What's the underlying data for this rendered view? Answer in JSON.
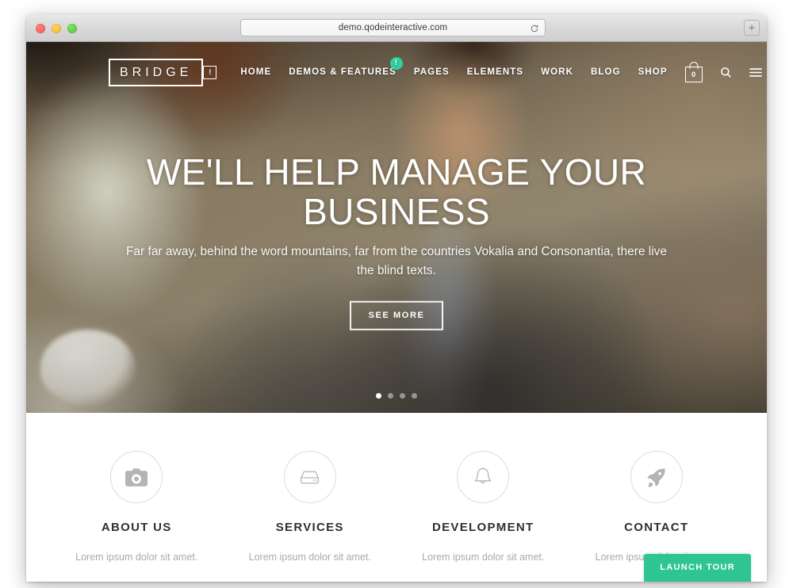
{
  "browser": {
    "url": "demo.qodeinteractive.com",
    "reload_icon": "reload-icon",
    "newtab_label": "+",
    "traffic_lights": [
      "close",
      "minimize",
      "maximize"
    ]
  },
  "site": {
    "logo": "BRIDGE",
    "nav": {
      "pre_icon_label": "!",
      "items": [
        {
          "label": "HOME",
          "badge": null
        },
        {
          "label": "DEMOS & FEATURES",
          "badge": "!"
        },
        {
          "label": "PAGES",
          "badge": null
        },
        {
          "label": "ELEMENTS",
          "badge": null
        },
        {
          "label": "WORK",
          "badge": null
        },
        {
          "label": "BLOG",
          "badge": null
        },
        {
          "label": "SHOP",
          "badge": null
        }
      ],
      "cart_count": "0",
      "search_icon": "search-icon",
      "menu_icon": "hamburger-icon"
    },
    "hero": {
      "title": "WE'LL HELP MANAGE YOUR BUSINESS",
      "subtitle": "Far far away, behind the word mountains, far from the countries Vokalia and Consonantia, there live the blind texts.",
      "button_label": "SEE MORE",
      "slider_dots": 4,
      "slider_active_index": 0
    },
    "features": [
      {
        "icon": "camera-icon",
        "title": "ABOUT US",
        "text": "Lorem ipsum dolor sit amet."
      },
      {
        "icon": "drive-icon",
        "title": "SERVICES",
        "text": "Lorem ipsum dolor sit amet."
      },
      {
        "icon": "bell-icon",
        "title": "DEVELOPMENT",
        "text": "Lorem ipsum dolor sit amet."
      },
      {
        "icon": "rocket-icon",
        "title": "CONTACT",
        "text": "Lorem ipsum dolor sit amet."
      }
    ],
    "launch_tour_label": "LAUNCH TOUR"
  },
  "colors": {
    "accent_green": "#2ec592",
    "badge_green": "#2ecfa0",
    "heading": "#2f2f2f",
    "muted_text": "#a9a9a9"
  }
}
